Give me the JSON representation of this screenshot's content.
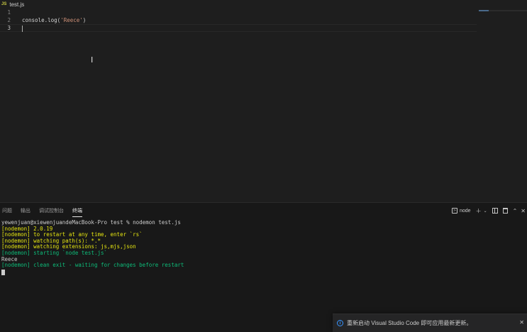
{
  "breadcrumb": {
    "icon_label": "JS",
    "file": "test.js"
  },
  "editor": {
    "lines": [
      {
        "num": "1",
        "fn": "",
        "str": "",
        "end": ""
      },
      {
        "num": "2",
        "fn": "console.log(",
        "str": "'Reece'",
        "end": ")"
      },
      {
        "num": "3",
        "fn": "",
        "str": "",
        "end": ""
      }
    ],
    "active_line": "3"
  },
  "panel": {
    "tabs": [
      {
        "label": "问题",
        "active": false
      },
      {
        "label": "输出",
        "active": false
      },
      {
        "label": "调试控制台",
        "active": false
      },
      {
        "label": "终端",
        "active": true
      }
    ],
    "terminal_name": "node",
    "action_icons": [
      "terminal-icon",
      "plus-icon",
      "chevron-down-icon",
      "split-icon",
      "trash-icon",
      "chevron-up-icon",
      "close-icon"
    ]
  },
  "terminal": {
    "lines": [
      {
        "text": "yewenjuan@xiewenjuandeMacBook-Pro test % nodemon test.js",
        "color": "plain"
      },
      {
        "text": "[nodemon] 2.0.19",
        "color": "yellow"
      },
      {
        "text": "[nodemon] to restart at any time, enter `rs`",
        "color": "yellow"
      },
      {
        "text": "[nodemon] watching path(s): *.*",
        "color": "yellow"
      },
      {
        "text": "[nodemon] watching extensions: js,mjs,json",
        "color": "yellow"
      },
      {
        "text": "[nodemon] starting `node test.js`",
        "color": "green"
      },
      {
        "text": "Reece",
        "color": "plain"
      },
      {
        "text": "[nodemon] clean exit - waiting for changes before restart",
        "color": "green"
      }
    ]
  },
  "notification": {
    "icon": "info-icon",
    "message": "重新启动 Visual Studio Code 即可应用最新更新。"
  },
  "colors": {
    "yellow": "#e5e510",
    "green": "#0dbc79",
    "string": "#ce9178",
    "info": "#3794ff"
  }
}
